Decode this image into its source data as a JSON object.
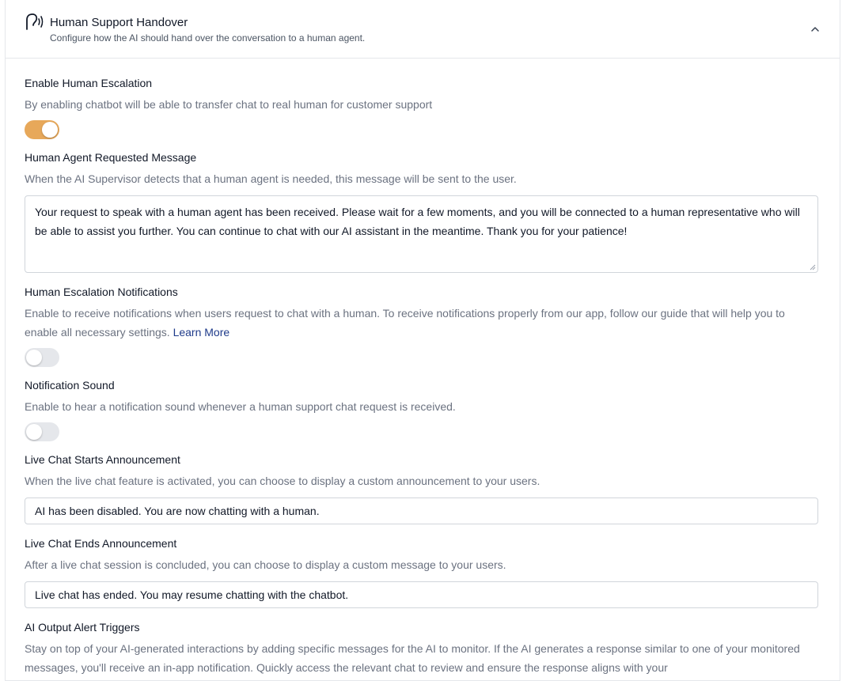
{
  "header": {
    "title": "Human Support Handover",
    "subtitle": "Configure how the AI should hand over the conversation to a human agent.",
    "icon": "human-voice-icon"
  },
  "escalation": {
    "label": "Enable Human Escalation",
    "description": "By enabling chatbot will be able to transfer chat to real human for customer support",
    "enabled": true
  },
  "requested_message": {
    "label": "Human Agent Requested Message",
    "description": "When the AI Supervisor detects that a human agent is needed, this message will be sent to the user.",
    "value": "Your request to speak with a human agent has been received. Please wait for a few moments, and you will be connected to a human representative who will be able to assist you further. You can continue to chat with our AI assistant in the meantime. Thank you for your patience!"
  },
  "notifications": {
    "label": "Human Escalation Notifications",
    "description": "Enable to receive notifications when users request to chat with a human. To receive notifications properly from our app, follow our guide that will help you to enable all necessary settings.",
    "link": "Learn More",
    "enabled": false
  },
  "sound": {
    "label": "Notification Sound",
    "description": "Enable to hear a notification sound whenever a human support chat request is received.",
    "enabled": false
  },
  "starts": {
    "label": "Live Chat Starts Announcement",
    "description": "When the live chat feature is activated, you can choose to display a custom announcement to your users.",
    "value": "AI has been disabled. You are now chatting with a human."
  },
  "ends": {
    "label": "Live Chat Ends Announcement",
    "description": "After a live chat session is concluded, you can choose to display a custom message to your users.",
    "value": "Live chat has ended. You may resume chatting with the chatbot."
  },
  "alerts": {
    "label": "AI Output Alert Triggers",
    "description": "Stay on top of your AI-generated interactions by adding specific messages for the AI to monitor. If the AI generates a response similar to one of your monitored messages, you'll receive an in-app notification. Quickly access the relevant chat to review and ensure the response aligns with your"
  },
  "colors": {
    "toggle_on": "#e7a85a",
    "toggle_off": "#e5e7eb",
    "link": "#1e3a8a"
  }
}
